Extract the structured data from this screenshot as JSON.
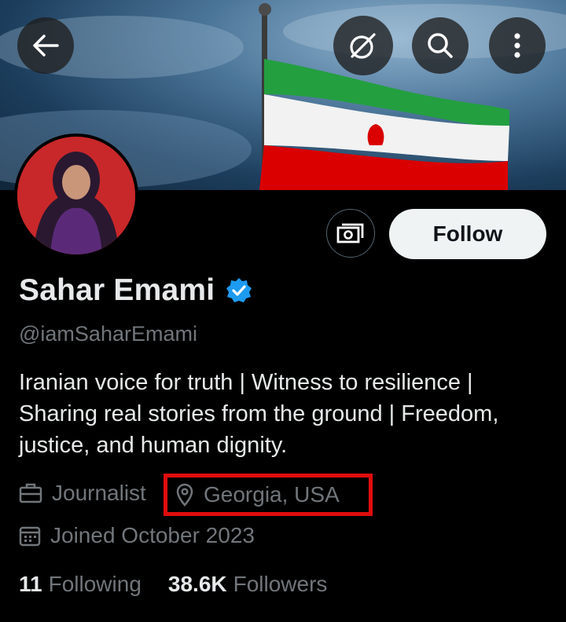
{
  "header": {
    "back_icon": "arrow-left-icon",
    "grok_icon": "grok-slash-circle-icon",
    "search_icon": "search-icon",
    "more_icon": "more-vertical-icon"
  },
  "banner": {
    "description_colors": {
      "sky": "#4b7598",
      "flag_green": "#239f40",
      "flag_white": "#f2f2f2",
      "flag_red": "#da0000"
    }
  },
  "actions": {
    "subscribe_icon": "money-subscribe-icon",
    "follow_label": "Follow"
  },
  "profile": {
    "name": "Sahar Emami",
    "verified": true,
    "handle": "@iamSaharEmami",
    "bio": "Iranian voice for truth | Witness to resilience | Sharing real stories from the ground | Freedom, justice, and human dignity.",
    "profession": "Journalist",
    "location": "Georgia, USA",
    "joined": "Joined October 2023"
  },
  "stats": {
    "following_count": "11",
    "following_label": "Following",
    "followers_count": "38.6K",
    "followers_label": "Followers"
  },
  "colors": {
    "background": "#000000",
    "text_primary": "#e7e9ea",
    "text_secondary": "#71767b",
    "verified_blue": "#1d9bf0",
    "highlight_box": "#e00d0d"
  }
}
